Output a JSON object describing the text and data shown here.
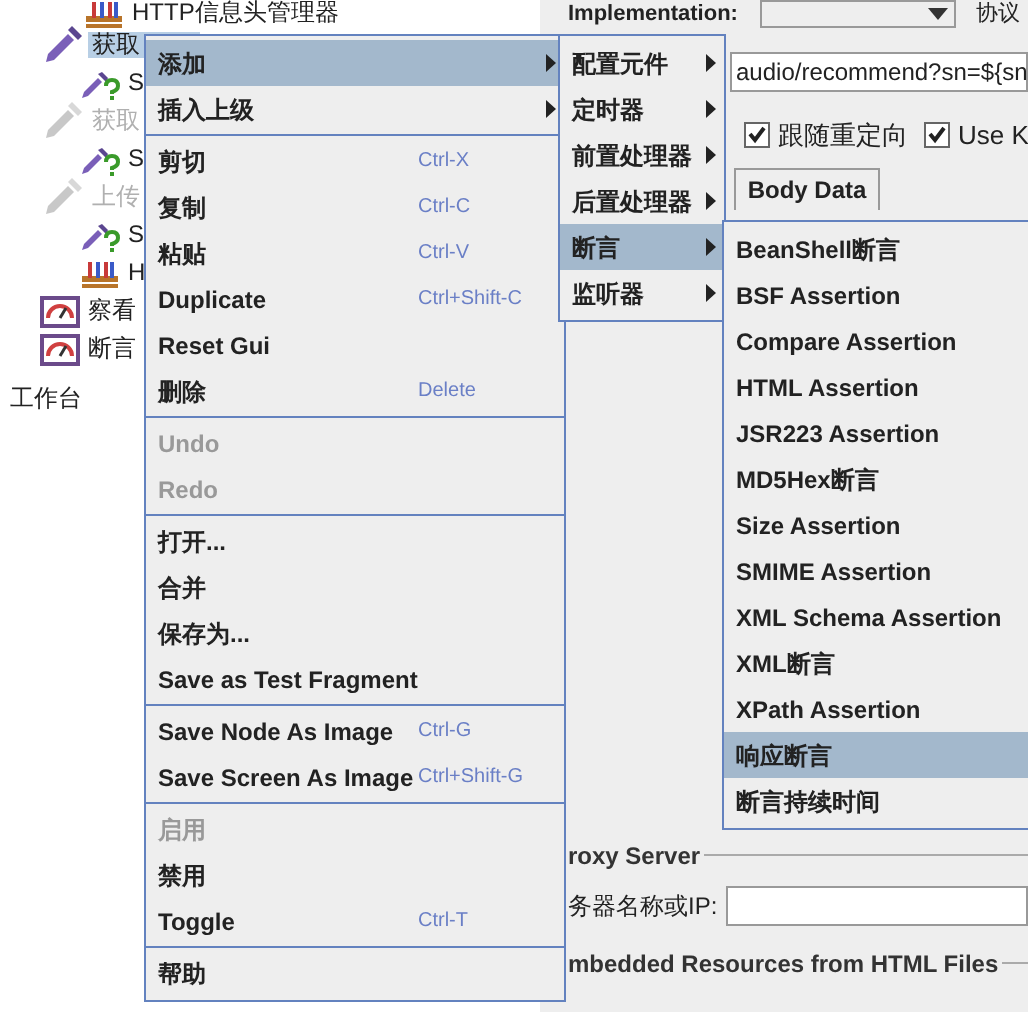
{
  "tree": [
    {
      "label": "HTTP信息头管理器",
      "kind": "rack",
      "disabled": false,
      "selected": false
    },
    {
      "label": "获取",
      "kind": "sampler",
      "disabled": false,
      "selected": true,
      "children": [
        {
          "label": "S",
          "kind": "check",
          "disabled": false,
          "selected": false
        }
      ]
    },
    {
      "label": "获取",
      "kind": "sampler",
      "disabled": true,
      "selected": false,
      "children": [
        {
          "label": "S",
          "kind": "check",
          "disabled": false,
          "selected": false
        }
      ]
    },
    {
      "label": "上传",
      "kind": "sampler",
      "disabled": true,
      "selected": false,
      "children": [
        {
          "label": "S",
          "kind": "check",
          "disabled": false,
          "selected": false
        },
        {
          "label": "H",
          "kind": "rack",
          "disabled": false,
          "selected": false
        }
      ]
    },
    {
      "label": "察看",
      "kind": "listener",
      "disabled": false,
      "selected": false
    },
    {
      "label": "断言",
      "kind": "listener",
      "disabled": false,
      "selected": false
    }
  ],
  "workbench": "工作台",
  "panel": {
    "implementation_label": "Implementation:",
    "protocol_label": "协议",
    "path": "audio/recommend?sn=${sn",
    "checkboxes": [
      {
        "label": "跟随重定向",
        "checked": true
      },
      {
        "label": "Use K",
        "checked": true
      }
    ],
    "tab": "Body Data",
    "proxy_title": "roxy Server",
    "server_label": "务器名称或IP:",
    "embedded_title": "mbedded Resources from HTML Files"
  },
  "context_menu": [
    {
      "kind": "item",
      "label": "添加",
      "submenu": true,
      "selected": true,
      "disabled": false
    },
    {
      "kind": "item",
      "label": "插入上级",
      "submenu": true,
      "selected": false,
      "disabled": false
    },
    {
      "kind": "separator"
    },
    {
      "kind": "item",
      "label": "剪切",
      "shortcut": "Ctrl-X",
      "selected": false,
      "disabled": false
    },
    {
      "kind": "item",
      "label": "复制",
      "shortcut": "Ctrl-C",
      "selected": false,
      "disabled": false
    },
    {
      "kind": "item",
      "label": "粘贴",
      "shortcut": "Ctrl-V",
      "selected": false,
      "disabled": false
    },
    {
      "kind": "item",
      "label": "Duplicate",
      "shortcut": "Ctrl+Shift-C",
      "selected": false,
      "disabled": false
    },
    {
      "kind": "item",
      "label": "Reset Gui",
      "selected": false,
      "disabled": false
    },
    {
      "kind": "item",
      "label": "删除",
      "shortcut": "Delete",
      "selected": false,
      "disabled": false
    },
    {
      "kind": "separator"
    },
    {
      "kind": "item",
      "label": "Undo",
      "selected": false,
      "disabled": true
    },
    {
      "kind": "item",
      "label": "Redo",
      "selected": false,
      "disabled": true
    },
    {
      "kind": "separator"
    },
    {
      "kind": "item",
      "label": "打开...",
      "selected": false,
      "disabled": false
    },
    {
      "kind": "item",
      "label": "合并",
      "selected": false,
      "disabled": false
    },
    {
      "kind": "item",
      "label": "保存为...",
      "selected": false,
      "disabled": false
    },
    {
      "kind": "item",
      "label": "Save as Test Fragment",
      "selected": false,
      "disabled": false
    },
    {
      "kind": "separator"
    },
    {
      "kind": "item",
      "label": "Save Node As Image",
      "shortcut": "Ctrl-G",
      "selected": false,
      "disabled": false
    },
    {
      "kind": "item",
      "label": "Save Screen As Image",
      "shortcut": "Ctrl+Shift-G",
      "selected": false,
      "disabled": false
    },
    {
      "kind": "separator"
    },
    {
      "kind": "item",
      "label": "启用",
      "selected": false,
      "disabled": true
    },
    {
      "kind": "item",
      "label": "禁用",
      "selected": false,
      "disabled": false
    },
    {
      "kind": "item",
      "label": "Toggle",
      "shortcut": "Ctrl-T",
      "selected": false,
      "disabled": false
    },
    {
      "kind": "separator"
    },
    {
      "kind": "item",
      "label": "帮助",
      "selected": false,
      "disabled": false
    }
  ],
  "add_menu": [
    {
      "kind": "item",
      "label": "配置元件",
      "submenu": true,
      "selected": false,
      "disabled": false
    },
    {
      "kind": "item",
      "label": "定时器",
      "submenu": true,
      "selected": false,
      "disabled": false
    },
    {
      "kind": "item",
      "label": "前置处理器",
      "submenu": true,
      "selected": false,
      "disabled": false
    },
    {
      "kind": "item",
      "label": "后置处理器",
      "submenu": true,
      "selected": false,
      "disabled": false
    },
    {
      "kind": "item",
      "label": "断言",
      "submenu": true,
      "selected": true,
      "disabled": false
    },
    {
      "kind": "item",
      "label": "监听器",
      "submenu": true,
      "selected": false,
      "disabled": false
    }
  ],
  "assertion_menu": [
    {
      "kind": "item",
      "label": "BeanShell断言",
      "selected": false,
      "disabled": false
    },
    {
      "kind": "item",
      "label": "BSF Assertion",
      "selected": false,
      "disabled": false
    },
    {
      "kind": "item",
      "label": "Compare Assertion",
      "selected": false,
      "disabled": false
    },
    {
      "kind": "item",
      "label": "HTML Assertion",
      "selected": false,
      "disabled": false
    },
    {
      "kind": "item",
      "label": "JSR223 Assertion",
      "selected": false,
      "disabled": false
    },
    {
      "kind": "item",
      "label": "MD5Hex断言",
      "selected": false,
      "disabled": false
    },
    {
      "kind": "item",
      "label": "Size Assertion",
      "selected": false,
      "disabled": false
    },
    {
      "kind": "item",
      "label": "SMIME Assertion",
      "selected": false,
      "disabled": false
    },
    {
      "kind": "item",
      "label": "XML Schema Assertion",
      "selected": false,
      "disabled": false
    },
    {
      "kind": "item",
      "label": "XML断言",
      "selected": false,
      "disabled": false
    },
    {
      "kind": "item",
      "label": "XPath Assertion",
      "selected": false,
      "disabled": false
    },
    {
      "kind": "item",
      "label": "响应断言",
      "selected": true,
      "disabled": false
    },
    {
      "kind": "item",
      "label": "断言持续时间",
      "selected": false,
      "disabled": false
    }
  ]
}
